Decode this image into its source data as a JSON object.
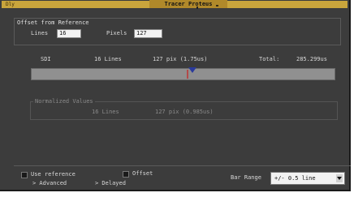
{
  "window": {
    "title_left": "Dly",
    "title_center": "Tracer Proteus"
  },
  "offset": {
    "group_label": "Offset from Reference",
    "lines_label": "Lines",
    "lines_value": "16",
    "pixels_label": "Pixels",
    "pixels_value": "127"
  },
  "status": {
    "sdi_label": "SDI",
    "lines_text": "16 Lines",
    "pixels_text": "127 pix (1.75us)",
    "total_label": "Total:",
    "total_value": "285.299us",
    "slider_position_fraction": 0.53
  },
  "normalized": {
    "legend": "Normalized Values",
    "lines_text": "16 Lines",
    "pixels_text": "127 pix (0.985us)"
  },
  "bottom": {
    "use_reference_label": "Use reference",
    "offset_label": "Offset",
    "advanced_label": "> Advanced",
    "delayed_label": "> Delayed",
    "bar_range_label": "Bar Range",
    "bar_range_value": "+/- 0.5 line"
  }
}
